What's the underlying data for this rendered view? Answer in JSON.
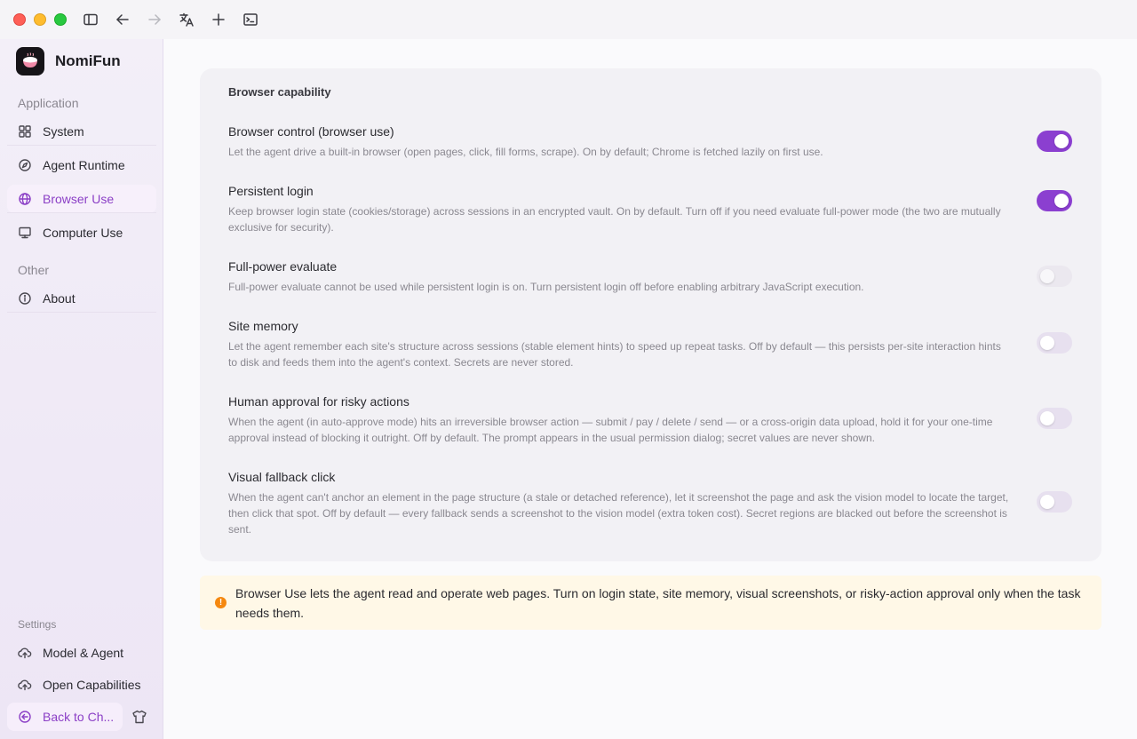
{
  "app": {
    "name": "NomiFun"
  },
  "sidebar": {
    "section_application": "Application",
    "section_other": "Other",
    "section_settings": "Settings",
    "items": [
      {
        "label": "System",
        "icon": "grid-icon"
      },
      {
        "label": "Agent Runtime",
        "icon": "compass-icon"
      },
      {
        "label": "Browser Use",
        "icon": "globe-icon",
        "active": true
      },
      {
        "label": "Computer Use",
        "icon": "monitor-icon"
      },
      {
        "label": "About",
        "icon": "info-icon"
      },
      {
        "label": "Model & Agent",
        "icon": "cloud-sync-icon"
      },
      {
        "label": "Open Capabilities",
        "icon": "cloud-sync-icon"
      }
    ],
    "back_label": "Back to Ch..."
  },
  "card": {
    "title": "Browser capability",
    "settings": [
      {
        "title": "Browser control (browser use)",
        "desc": "Let the agent drive a built-in browser (open pages, click, fill forms, scrape). On by default; Chrome is fetched lazily on first use.",
        "state": "on"
      },
      {
        "title": "Persistent login",
        "desc": "Keep browser login state (cookies/storage) across sessions in an encrypted vault. On by default. Turn off if you need evaluate full-power mode (the two are mutually exclusive for security).",
        "state": "on"
      },
      {
        "title": "Full-power evaluate",
        "desc": "Full-power evaluate cannot be used while persistent login is on. Turn persistent login off before enabling arbitrary JavaScript execution.",
        "state": "disabled"
      },
      {
        "title": "Site memory",
        "desc": "Let the agent remember each site's structure across sessions (stable element hints) to speed up repeat tasks. Off by default — this persists per-site interaction hints to disk and feeds them into the agent's context. Secrets are never stored.",
        "state": "off"
      },
      {
        "title": "Human approval for risky actions",
        "desc": "When the agent (in auto-approve mode) hits an irreversible browser action — submit / pay / delete / send — or a cross-origin data upload, hold it for your one-time approval instead of blocking it outright. Off by default. The prompt appears in the usual permission dialog; secret values are never shown.",
        "state": "off"
      },
      {
        "title": "Visual fallback click",
        "desc": "When the agent can't anchor an element in the page structure (a stale or detached reference), let it screenshot the page and ask the vision model to locate the target, then click that spot. Off by default — every fallback sends a screenshot to the vision model (extra token cost). Secret regions are blacked out before the screenshot is sent.",
        "state": "off"
      }
    ]
  },
  "notice": {
    "icon": "warning-icon",
    "text": "Browser Use lets the agent read and operate web pages. Turn on login state, site memory, visual screenshots, or risky-action approval only when the task needs them."
  },
  "colors": {
    "accent": "#8b3fd0",
    "notice_bg": "#fff8e7",
    "notice_icon": "#f5880f"
  }
}
